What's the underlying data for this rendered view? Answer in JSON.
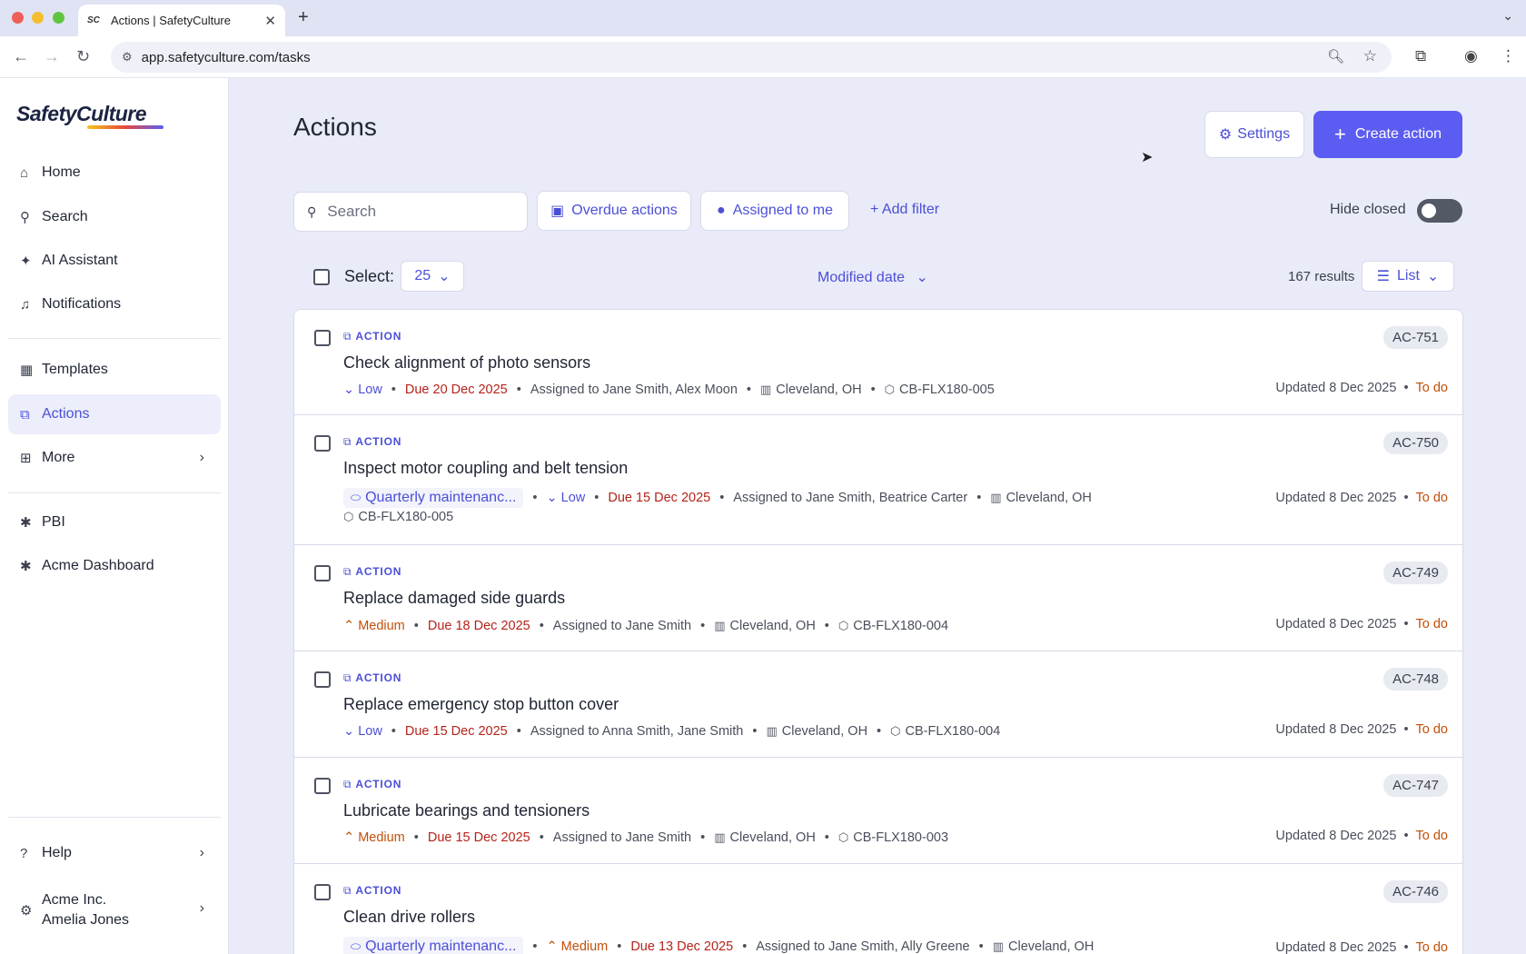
{
  "browser": {
    "tab_title": "Actions | SafetyCulture",
    "tab_favicon": "SC",
    "url": "app.safetyculture.com/tasks"
  },
  "sidebar": {
    "logo": "SafetyCulture",
    "nav": [
      {
        "label": "Home",
        "icon": "home-icon"
      },
      {
        "label": "Search",
        "icon": "search-icon"
      },
      {
        "label": "AI Assistant",
        "icon": "sparkle-icon"
      },
      {
        "label": "Notifications",
        "icon": "bell-icon"
      },
      {
        "label": "Templates",
        "icon": "template-icon"
      },
      {
        "label": "Actions",
        "icon": "actions-icon",
        "active": true
      },
      {
        "label": "More",
        "icon": "grid-icon"
      },
      {
        "label": "PBI",
        "icon": "puzzle-icon"
      },
      {
        "label": "Acme Dashboard",
        "icon": "puzzle-icon"
      },
      {
        "label": "Help",
        "icon": "help-icon"
      }
    ],
    "org": {
      "name": "Acme Inc.",
      "user": "Amelia Jones"
    }
  },
  "header": {
    "title": "Actions",
    "settings_label": "Settings",
    "create_label": "Create action"
  },
  "filters": {
    "search_placeholder": "Search",
    "overdue_label": "Overdue actions",
    "assigned_label": "Assigned to me",
    "add_filter_label": "Add filter",
    "hide_closed_label": "Hide closed"
  },
  "list_controls": {
    "select_label": "Select:",
    "page_size": "25",
    "sort_label": "Modified date",
    "results": "167 results",
    "view_label": "List"
  },
  "actions": [
    {
      "kind": "ACTION",
      "title": "Check alignment of photo sensors",
      "priority": "Low",
      "due": "Due 20 Dec 2025",
      "assigned": "Assigned to Jane Smith, Alex Moon",
      "site": "Cleveland, OH",
      "asset": "CB-FLX180-005",
      "template": "",
      "ref": "AC-751",
      "updated": "Updated 8 Dec 2025",
      "status": "To do"
    },
    {
      "kind": "ACTION",
      "title": "Inspect motor coupling and belt tension",
      "priority": "Low",
      "due": "Due 15 Dec 2025",
      "assigned": "Assigned to Jane Smith, Beatrice Carter",
      "site": "Cleveland, OH",
      "asset": "CB-FLX180-005",
      "template": "Quarterly maintenanc...",
      "ref": "AC-750",
      "updated": "Updated 8 Dec 2025",
      "status": "To do"
    },
    {
      "kind": "ACTION",
      "title": "Replace damaged side guards",
      "priority": "Medium",
      "due": "Due 18 Dec 2025",
      "assigned": "Assigned to Jane Smith",
      "site": "Cleveland, OH",
      "asset": "CB-FLX180-004",
      "template": "",
      "ref": "AC-749",
      "updated": "Updated 8 Dec 2025",
      "status": "To do"
    },
    {
      "kind": "ACTION",
      "title": "Replace emergency stop button cover",
      "priority": "Low",
      "due": "Due 15 Dec 2025",
      "assigned": "Assigned to Anna Smith, Jane Smith",
      "site": "Cleveland, OH",
      "asset": "CB-FLX180-004",
      "template": "",
      "ref": "AC-748",
      "updated": "Updated 8 Dec 2025",
      "status": "To do"
    },
    {
      "kind": "ACTION",
      "title": "Lubricate bearings and tensioners",
      "priority": "Medium",
      "due": "Due 15 Dec 2025",
      "assigned": "Assigned to Jane Smith",
      "site": "Cleveland, OH",
      "asset": "CB-FLX180-003",
      "template": "",
      "ref": "AC-747",
      "updated": "Updated 8 Dec 2025",
      "status": "To do"
    },
    {
      "kind": "ACTION",
      "title": "Clean drive rollers",
      "priority": "Medium",
      "due": "Due 13 Dec 2025",
      "assigned": "Assigned to Jane Smith, Ally Greene",
      "site": "Cleveland, OH",
      "asset": "",
      "template": "Quarterly maintenanc...",
      "ref": "AC-746",
      "updated": "Updated 8 Dec 2025",
      "status": "To do"
    }
  ]
}
